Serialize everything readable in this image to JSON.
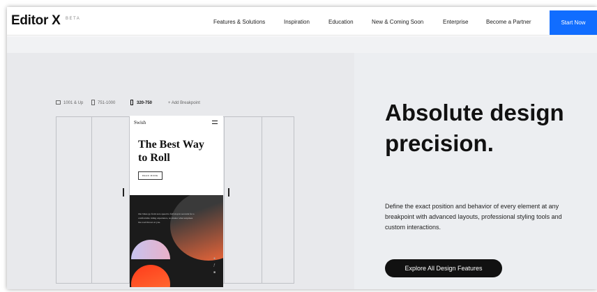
{
  "nav": {
    "logo": "Editor X",
    "beta": "BETA",
    "items": [
      "Features & Solutions",
      "Inspiration",
      "Education",
      "New & Coming Soon",
      "Enterprise",
      "Become a Partner"
    ],
    "cta": "Start Now",
    "cta_color": "#116dff"
  },
  "breakpoints": {
    "items": [
      "1001 & Up",
      "751-1000",
      "320-750"
    ],
    "active": "320-750",
    "add": "+ Add Breakpoint"
  },
  "preview": {
    "brand": "Swish",
    "title": "The Best Way to Roll",
    "button": "READ MORE",
    "paragraph": "Our bikes go from zero speed to full stop in seconds for a comfortable riding experience, no matter what surprises the road throws at you.",
    "social": [
      "twitter-icon",
      "facebook-icon",
      "linkedin-icon"
    ],
    "accent": "#ff6a39"
  },
  "hero": {
    "headline": "Absolute design precision.",
    "description": "Define the exact position and behavior of every element at any breakpoint with advanced layouts, professional styling tools and custom interactions.",
    "cta": "Explore All Design Features"
  }
}
